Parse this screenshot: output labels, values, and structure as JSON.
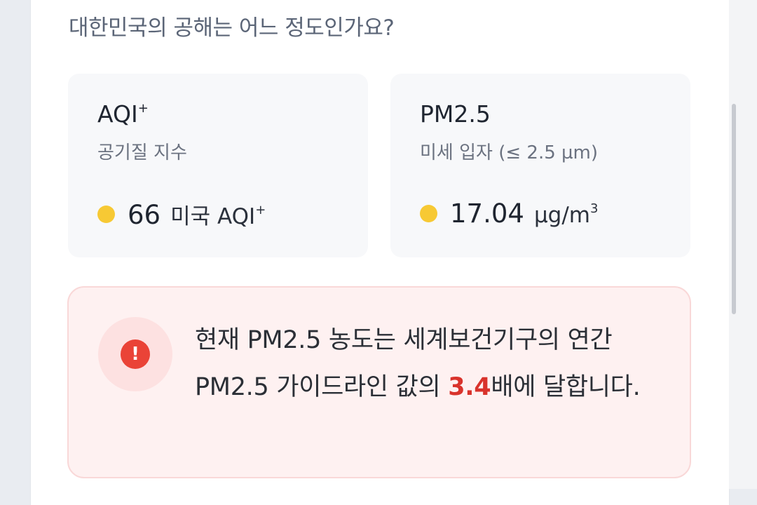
{
  "question": "대한민국의 공해는 어느 정도인가요?",
  "metrics": [
    {
      "title": "AQI",
      "title_sup": "+",
      "subtitle": "공기질 지수",
      "value": "66",
      "unit": "미국 AQI",
      "unit_sup": "+",
      "status_color": "#f7c934"
    },
    {
      "title": "PM2.5",
      "subtitle": "미세 입자 (≤ 2.5 µm)",
      "value": "17.04",
      "unit": "µg/m",
      "unit_sup": "3",
      "status_color": "#f7c934"
    }
  ],
  "alert": {
    "icon": "exclamation-icon",
    "text_before": "현재 PM2.5 농도는 세계보건기구의 연간 PM2.5 가이드라인 값의 ",
    "highlight": "3.4",
    "text_after": "배에 달합니다.",
    "highlight_color": "#d9332c"
  }
}
